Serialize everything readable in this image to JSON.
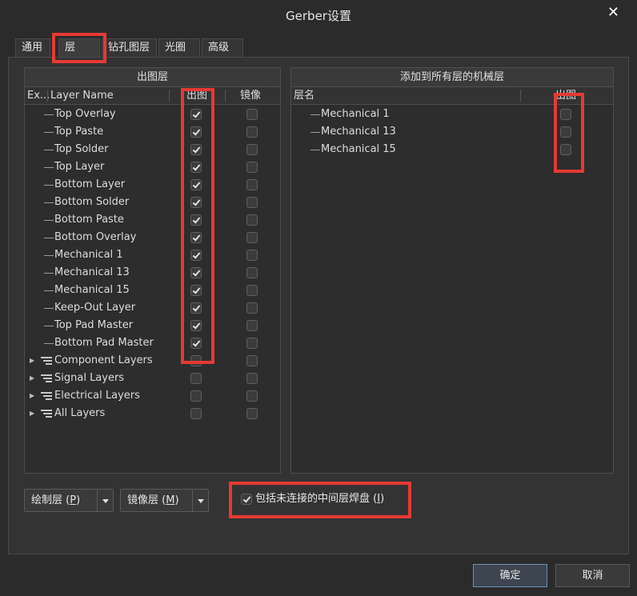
{
  "window": {
    "title": "Gerber设置",
    "close_glyph": "✕"
  },
  "tabs": [
    {
      "label": "通用"
    },
    {
      "label": "层"
    },
    {
      "label": "钻孔图层"
    },
    {
      "label": "光圈"
    },
    {
      "label": "高级"
    }
  ],
  "left_panel": {
    "title": "出图层",
    "columns": {
      "expand": "Ex...",
      "layer_name": "Layer Name",
      "plot": "出图",
      "mirror": "镜像"
    },
    "layers": [
      {
        "name": "Top Overlay",
        "plot": true,
        "mirror": false,
        "group": false
      },
      {
        "name": "Top Paste",
        "plot": true,
        "mirror": false,
        "group": false
      },
      {
        "name": "Top Solder",
        "plot": true,
        "mirror": false,
        "group": false
      },
      {
        "name": "Top Layer",
        "plot": true,
        "mirror": false,
        "group": false
      },
      {
        "name": "Bottom Layer",
        "plot": true,
        "mirror": false,
        "group": false
      },
      {
        "name": "Bottom Solder",
        "plot": true,
        "mirror": false,
        "group": false
      },
      {
        "name": "Bottom Paste",
        "plot": true,
        "mirror": false,
        "group": false
      },
      {
        "name": "Bottom Overlay",
        "plot": true,
        "mirror": false,
        "group": false
      },
      {
        "name": "Mechanical 1",
        "plot": true,
        "mirror": false,
        "group": false
      },
      {
        "name": "Mechanical 13",
        "plot": true,
        "mirror": false,
        "group": false
      },
      {
        "name": "Mechanical 15",
        "plot": true,
        "mirror": false,
        "group": false
      },
      {
        "name": "Keep-Out Layer",
        "plot": true,
        "mirror": false,
        "group": false
      },
      {
        "name": "Top Pad Master",
        "plot": true,
        "mirror": false,
        "group": false
      },
      {
        "name": "Bottom Pad Master",
        "plot": true,
        "mirror": false,
        "group": false
      },
      {
        "name": "Component Layers",
        "plot": false,
        "mirror": false,
        "group": true
      },
      {
        "name": "Signal Layers",
        "plot": false,
        "mirror": false,
        "group": true
      },
      {
        "name": "Electrical Layers",
        "plot": false,
        "mirror": false,
        "group": true
      },
      {
        "name": "All Layers",
        "plot": false,
        "mirror": false,
        "group": true
      }
    ]
  },
  "right_panel": {
    "title": "添加到所有层的机械层",
    "columns": {
      "layer_name": "层名",
      "plot": "出图"
    },
    "layers": [
      {
        "name": "Mechanical 1",
        "plot": false
      },
      {
        "name": "Mechanical 13",
        "plot": false
      },
      {
        "name": "Mechanical 15",
        "plot": false
      }
    ]
  },
  "buttons": {
    "plot_layers": {
      "label": "绘制层 ",
      "mnemonic": "P"
    },
    "mirror_layers": {
      "label": "镜像层 ",
      "mnemonic": "M"
    },
    "ok": "确定",
    "cancel": "取消"
  },
  "option": {
    "label": "包括未连接的中间层焊盘 ",
    "mnemonic": "I",
    "checked": true
  },
  "colors": {
    "highlight": "#e53935",
    "background": "#2b2b2b"
  }
}
